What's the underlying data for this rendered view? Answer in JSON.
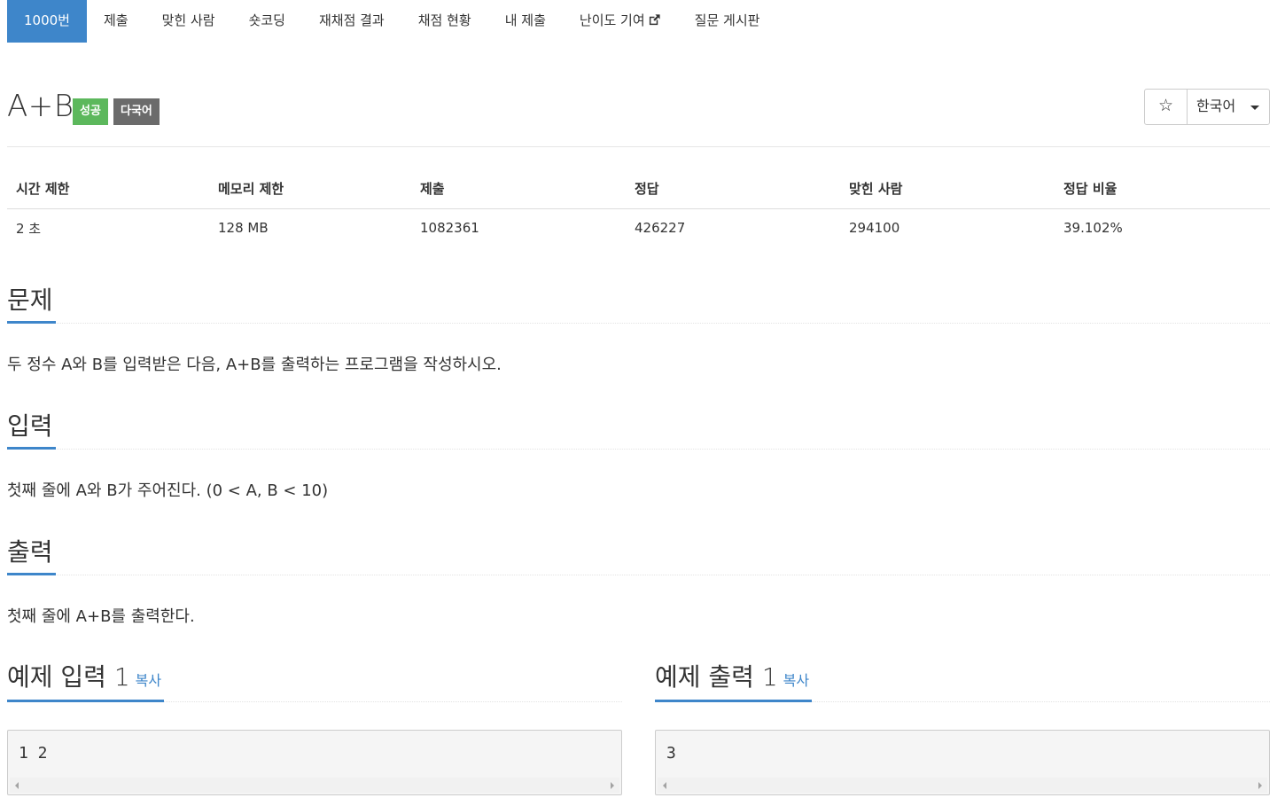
{
  "tabs": [
    {
      "label": "1000번",
      "active": true
    },
    {
      "label": "제출"
    },
    {
      "label": "맞힌 사람"
    },
    {
      "label": "숏코딩"
    },
    {
      "label": "재채점 결과"
    },
    {
      "label": "채점 현황"
    },
    {
      "label": "내 제출"
    },
    {
      "label": "난이도 기여",
      "icon": "external-link-icon"
    },
    {
      "label": "질문 게시판"
    }
  ],
  "problem": {
    "title": "A+B",
    "labels": {
      "success": "성공",
      "multi": "다국어"
    },
    "star_icon": "☆",
    "language": "한국어"
  },
  "info_table": {
    "headers": [
      "시간 제한",
      "메모리 제한",
      "제출",
      "정답",
      "맞힌 사람",
      "정답 비율"
    ],
    "values": [
      "2 초",
      "128 MB",
      "1082361",
      "426227",
      "294100",
      "39.102%"
    ]
  },
  "sections": {
    "problem": {
      "heading": "문제",
      "body": "두 정수 A와 B를 입력받은 다음, A+B를 출력하는 프로그램을 작성하시오."
    },
    "input": {
      "heading": "입력",
      "body": "첫째 줄에 A와 B가 주어진다. (0 < A, B < 10)"
    },
    "output": {
      "heading": "출력",
      "body": "첫째 줄에 A+B를 출력한다."
    }
  },
  "samples": {
    "input": {
      "heading": "예제 입력 1",
      "copy": "복사",
      "text": "1 2"
    },
    "output": {
      "heading": "예제 출력 1",
      "copy": "복사",
      "text": "3"
    }
  },
  "colors": {
    "accent": "#3e86ca",
    "success": "#5cb85c",
    "multi": "#6b6b6b"
  }
}
